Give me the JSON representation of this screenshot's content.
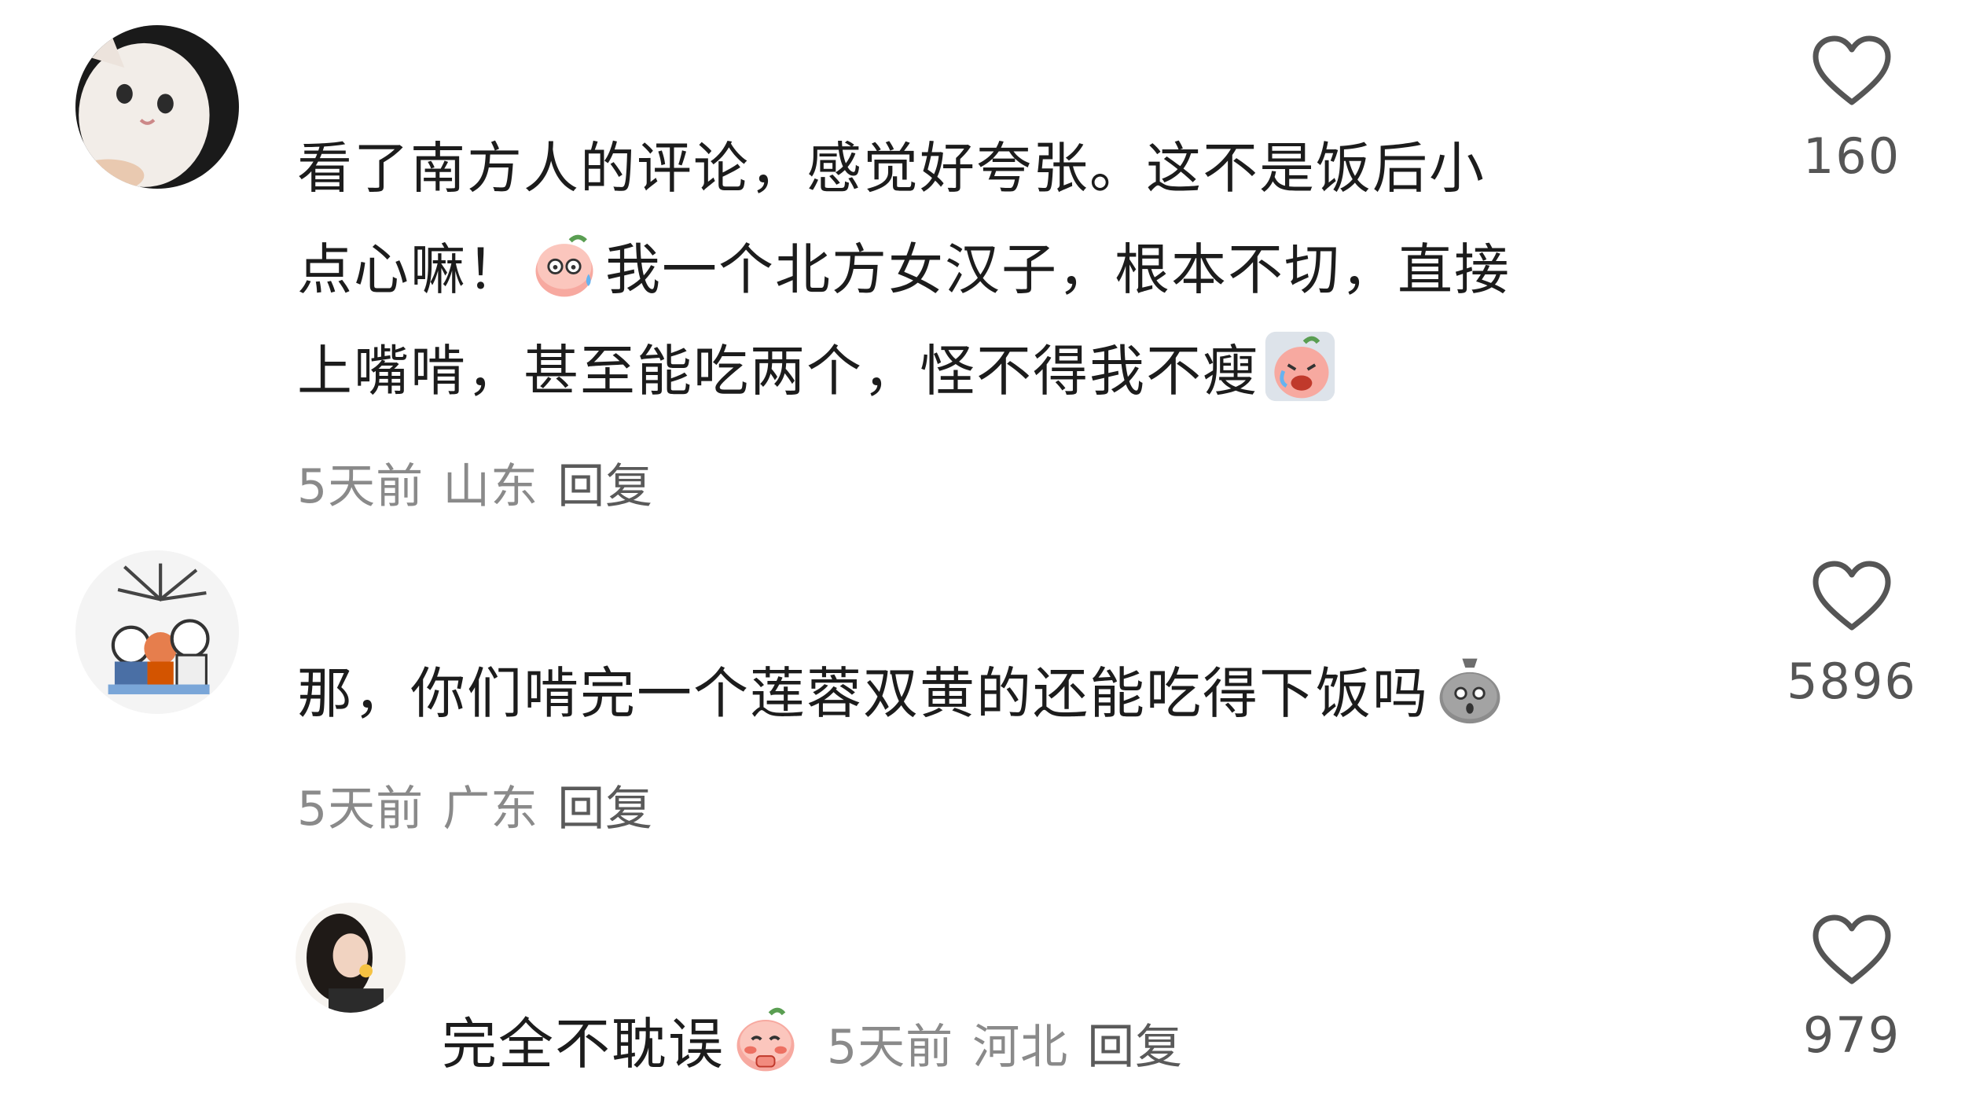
{
  "comments": [
    {
      "lines": [
        "看了南方人的评论，感觉好夸张。这不是饭后小",
        "点心嘛！",
        "我一个北方女汉子，根本不切，直接",
        "上嘴啃，甚至能吃两个，怪不得我不瘦"
      ],
      "time": "5天前",
      "location": "山东",
      "reply": "回复",
      "likes": "160",
      "emojis": [
        "sweat-peach-emoji",
        "crying-peach-emoji"
      ]
    },
    {
      "lines": [
        "那，你们啃完一个莲蓉双黄的还能吃得下饭吗"
      ],
      "time": "5天前",
      "location": "广东",
      "reply": "回复",
      "likes": "5896",
      "emojis": [
        "shocked-bag-emoji"
      ]
    },
    {
      "lines": [
        "完全不耽误"
      ],
      "time": "5天前",
      "location": "河北",
      "reply": "回复",
      "likes": "979",
      "emojis": [
        "blushing-peach-emoji"
      ]
    }
  ],
  "colors": {
    "text": "#1c1c1c",
    "meta": "#8a8a8a",
    "heart": "#555555"
  },
  "icons": {
    "like": "heart-outline-icon"
  }
}
